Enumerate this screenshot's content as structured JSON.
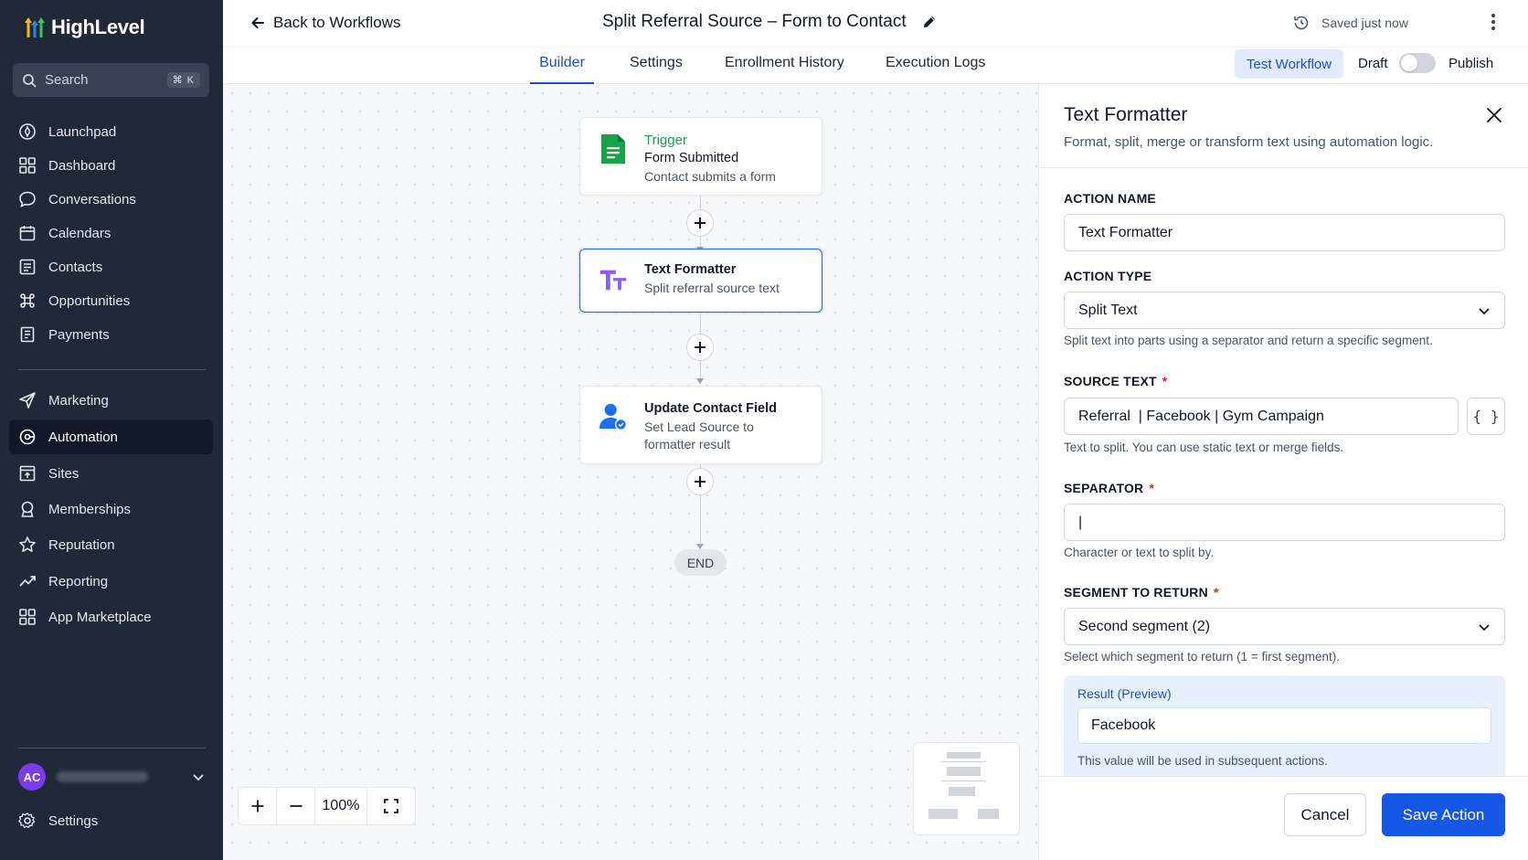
{
  "brand": {
    "name": "HighLevel"
  },
  "search": {
    "label": "Search",
    "shortcut": "⌘ K"
  },
  "nav": {
    "launchpad": "Launchpad",
    "dashboard": "Dashboard",
    "conversations": "Conversations",
    "calendars": "Calendars",
    "contacts": "Contacts",
    "opportunities": "Opportunities",
    "payments": "Payments",
    "marketing": "Marketing",
    "automation": "Automation",
    "sites": "Sites",
    "memberships": "Memberships",
    "reputation": "Reputation",
    "reporting": "Reporting",
    "app_marketplace": "App Marketplace",
    "settings": "Settings"
  },
  "user": {
    "initials": "AC"
  },
  "header": {
    "back_label": "Back to Workflows",
    "workflow_title": "Split Referral Source – Form to Contact",
    "saved_status": "Saved just now"
  },
  "tabs": {
    "builder": "Builder",
    "settings": "Settings",
    "enrollment_history": "Enrollment History",
    "execution_logs": "Execution Logs"
  },
  "actions": {
    "test_workflow": "Test Workflow",
    "draft": "Draft",
    "publish": "Publish"
  },
  "canvas": {
    "trigger": {
      "label": "Trigger",
      "title": "Form Submitted",
      "subtitle": "Contact submits a form"
    },
    "formatter": {
      "title": "Text Formatter",
      "subtitle": "Split referral source text"
    },
    "update": {
      "title": "Update Contact Field",
      "subtitle_1": "Set Lead Source to",
      "subtitle_2": "formatter result"
    },
    "end_label": "END",
    "zoom_level": "100%"
  },
  "panel": {
    "title": "Text Formatter",
    "description": "Format, split, merge or transform text using automation logic.",
    "action_name": {
      "label": "ACTION NAME",
      "value": "Text Formatter"
    },
    "action_type": {
      "label": "ACTION TYPE",
      "value": "Split Text",
      "help": "Split text into parts using a separator and return a specific segment."
    },
    "source_text": {
      "label": "SOURCE TEXT",
      "required": "*",
      "value": "Referral  | Facebook | Gym Campaign",
      "merge_label": "{ }",
      "help": "Text to split. You can use static text or merge fields."
    },
    "separator": {
      "label": "SEPARATOR",
      "required": "*",
      "value": "|",
      "help": "Character or text to split by."
    },
    "segment": {
      "label": "SEGMENT TO RETURN",
      "required": "*",
      "value": "Second segment (2)",
      "help": "Select which segment to return (1 = first segment)."
    },
    "preview": {
      "label": "Result (Preview)",
      "value": "Facebook",
      "help": "This value will be used in subsequent actions."
    },
    "cancel": "Cancel",
    "save": "Save Action"
  },
  "colors": {
    "sidebar_bg": "#1f2937",
    "accent_blue": "#1558e6",
    "trigger_green": "#16a34a",
    "formatter_purple": "#7c3aed"
  }
}
